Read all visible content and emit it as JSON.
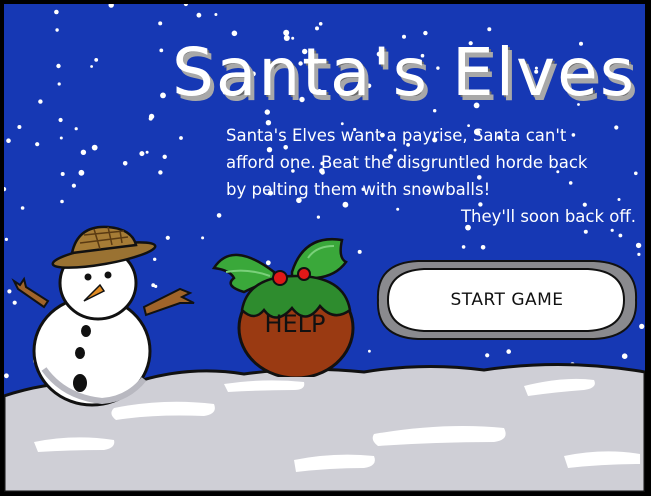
{
  "game": {
    "title": "Santa's Elves",
    "intro": {
      "line1": "Santa's Elves want a payrise, Santa can't",
      "line2": "afford one. Beat the disgruntled horde back",
      "line3": "by pelting them with snowballs!",
      "line4": "They'll soon back off."
    },
    "start_button_label": "START GAME",
    "help_button_label": "HELP"
  },
  "colors": {
    "sky": "#1638b4",
    "snow": "#cfcfd6",
    "pudding": "#9a3a12",
    "holly": "#3aa83a",
    "berry": "#e01818"
  }
}
